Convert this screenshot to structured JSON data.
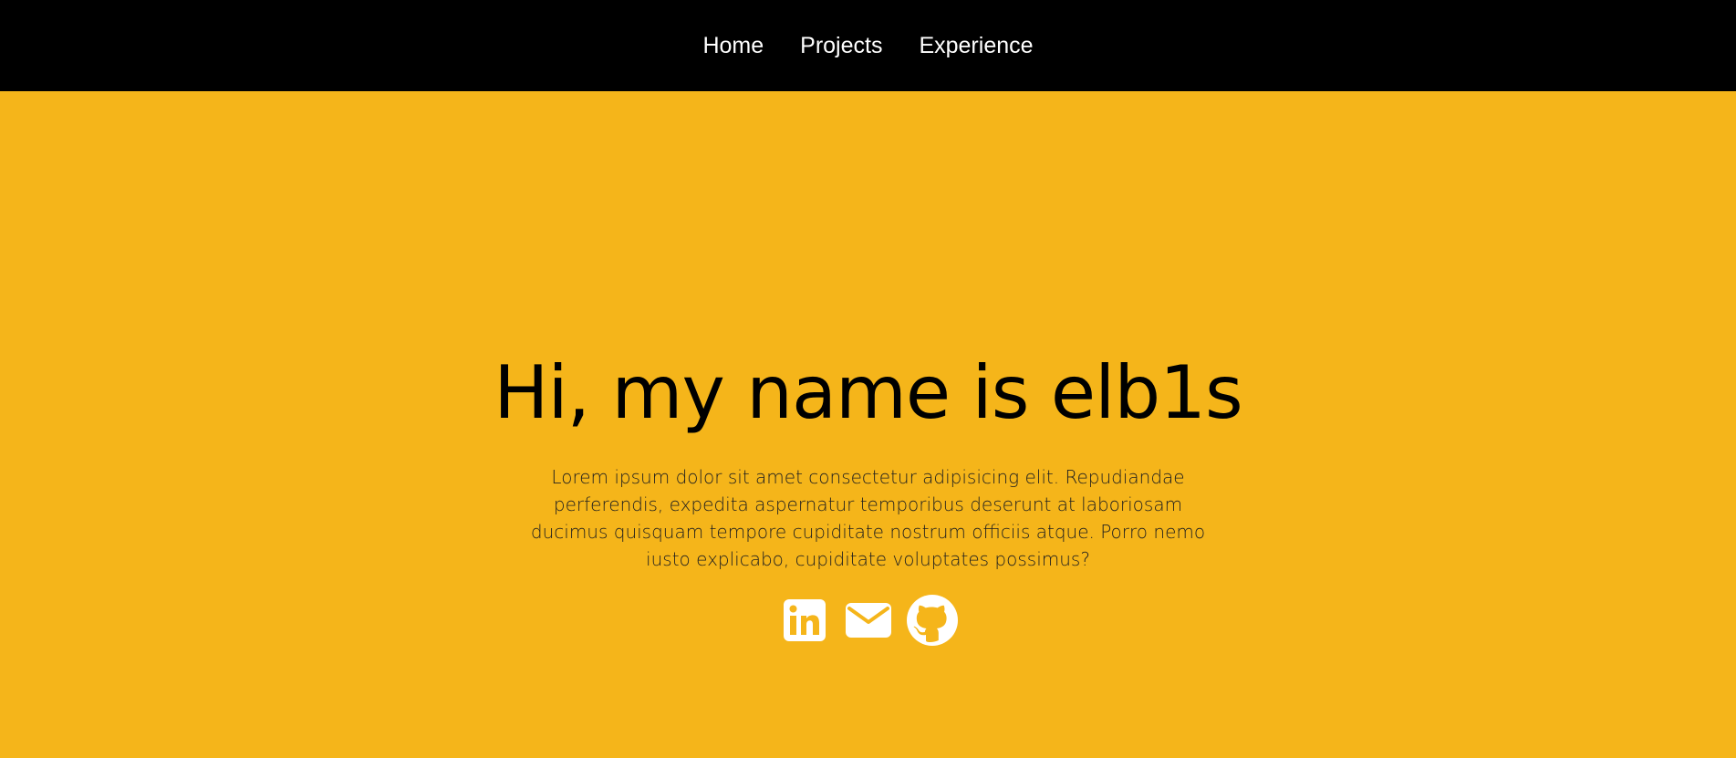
{
  "nav": {
    "items": [
      {
        "label": "Home"
      },
      {
        "label": "Projects"
      },
      {
        "label": "Experience"
      }
    ]
  },
  "hero": {
    "title": "Hi, my name is elb1s",
    "description": "Lorem ipsum dolor sit amet consectetur adipisicing elit. Repudiandae perferendis, expedita aspernatur temporibus deserunt at laboriosam ducimus quisquam tempore cupiditate nostrum officiis atque. Porro nemo iusto explicabo, cupiditate voluptates possimus?"
  },
  "socials": [
    {
      "icon": "linkedin-icon"
    },
    {
      "icon": "mail-icon"
    },
    {
      "icon": "github-icon"
    }
  ],
  "colors": {
    "nav_background": "#000000",
    "hero_background": "#f5b51a",
    "icon_color": "#ffffff"
  }
}
